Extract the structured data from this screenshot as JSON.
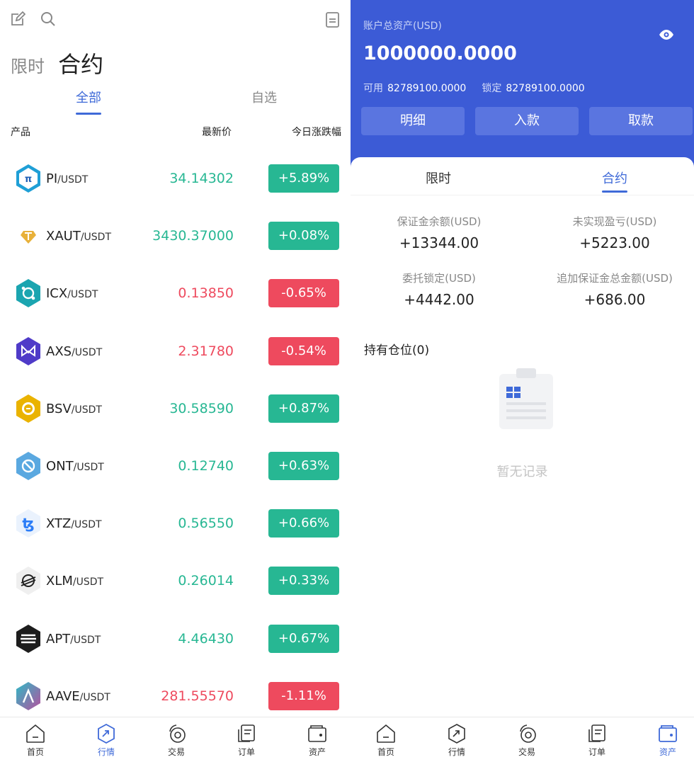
{
  "left": {
    "tabs": {
      "limit": "限时",
      "contract": "合约"
    },
    "sub_tabs": {
      "all": "全部",
      "fav": "自选"
    },
    "columns": {
      "product": "产品",
      "latest": "最新价",
      "change": "今日涨跌幅"
    },
    "rows": [
      {
        "base": "PI",
        "quote": "/USDT",
        "price": "34.14302",
        "change": "+5.89%",
        "dir": "up",
        "icon": "pi-coin-icon"
      },
      {
        "base": "XAUT",
        "quote": "/USDT",
        "price": "3430.37000",
        "change": "+0.08%",
        "dir": "up",
        "icon": "xaut-coin-icon"
      },
      {
        "base": "ICX",
        "quote": "/USDT",
        "price": "0.13850",
        "change": "-0.65%",
        "dir": "down",
        "icon": "icx-coin-icon"
      },
      {
        "base": "AXS",
        "quote": "/USDT",
        "price": "2.31780",
        "change": "-0.54%",
        "dir": "down",
        "icon": "axs-coin-icon"
      },
      {
        "base": "BSV",
        "quote": "/USDT",
        "price": "30.58590",
        "change": "+0.87%",
        "dir": "up",
        "icon": "bsv-coin-icon"
      },
      {
        "base": "ONT",
        "quote": "/USDT",
        "price": "0.12740",
        "change": "+0.63%",
        "dir": "up",
        "icon": "ont-coin-icon"
      },
      {
        "base": "XTZ",
        "quote": "/USDT",
        "price": "0.56550",
        "change": "+0.66%",
        "dir": "up",
        "icon": "xtz-coin-icon"
      },
      {
        "base": "XLM",
        "quote": "/USDT",
        "price": "0.26014",
        "change": "+0.33%",
        "dir": "up",
        "icon": "xlm-coin-icon"
      },
      {
        "base": "APT",
        "quote": "/USDT",
        "price": "4.46430",
        "change": "+0.67%",
        "dir": "up",
        "icon": "apt-coin-icon"
      },
      {
        "base": "AAVE",
        "quote": "/USDT",
        "price": "281.55570",
        "change": "-1.11%",
        "dir": "down",
        "icon": "aave-coin-icon"
      }
    ],
    "tabbar": {
      "home": "首页",
      "market": "行情",
      "trade": "交易",
      "orders": "订单",
      "assets": "资产"
    }
  },
  "right": {
    "account_label": "账户总资产(USD)",
    "account_value": "1000000.0000",
    "available_label": "可用",
    "available_value": "82789100.0000",
    "locked_label": "锁定",
    "locked_value": "82789100.0000",
    "buttons": {
      "detail": "明细",
      "deposit": "入款",
      "withdraw": "取款"
    },
    "tabs": {
      "limit": "限时",
      "contract": "合约"
    },
    "stats": {
      "margin_balance_label": "保证金余额(USD)",
      "margin_balance": "+13344.00",
      "unrealized_label": "未实现盈亏(USD)",
      "unrealized": "+5223.00",
      "order_locked_label": "委托锁定(USD)",
      "order_locked": "+4442.00",
      "added_margin_label": "追加保证金总金额(USD)",
      "added_margin": "+686.00"
    },
    "holding_title": "持有仓位(0)",
    "empty_text": "暂无记录",
    "tabbar": {
      "home": "首页",
      "market": "行情",
      "trade": "交易",
      "orders": "订单",
      "assets": "资产"
    }
  },
  "colors": {
    "accent": "#3f6ad8",
    "up": "#27b793",
    "down": "#ee4a5e",
    "header_blue": "#3c5bd6"
  }
}
